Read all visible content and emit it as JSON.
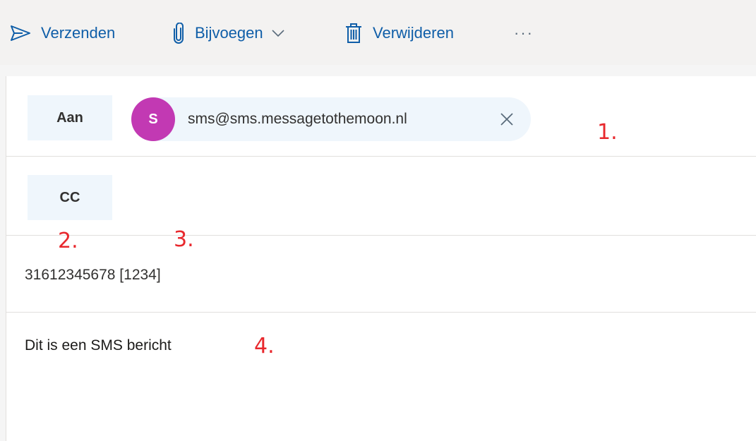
{
  "toolbar": {
    "send_label": "Verzenden",
    "attach_label": "Bijvoegen",
    "delete_label": "Verwijderen",
    "more_label": "···"
  },
  "fields": {
    "to_label": "Aan",
    "cc_label": "CC"
  },
  "recipient": {
    "initial": "S",
    "email": "sms@sms.messagetothemoon.nl",
    "avatar_color": "#c239b3"
  },
  "subject": {
    "value": "31612345678 [1234]"
  },
  "message": {
    "body": "Dit is een SMS bericht"
  },
  "annotations": {
    "a1": "1.",
    "a2": "2.",
    "a3": "3.",
    "a4": "4."
  },
  "colors": {
    "accent": "#0f5ea8",
    "field_bg": "#eff6fc",
    "annotation": "#e8282d"
  },
  "icons": {
    "send": "send-icon",
    "attach": "paperclip-icon",
    "attach_dropdown": "chevron-down-icon",
    "delete": "trash-icon",
    "remove_recipient": "close-icon"
  }
}
